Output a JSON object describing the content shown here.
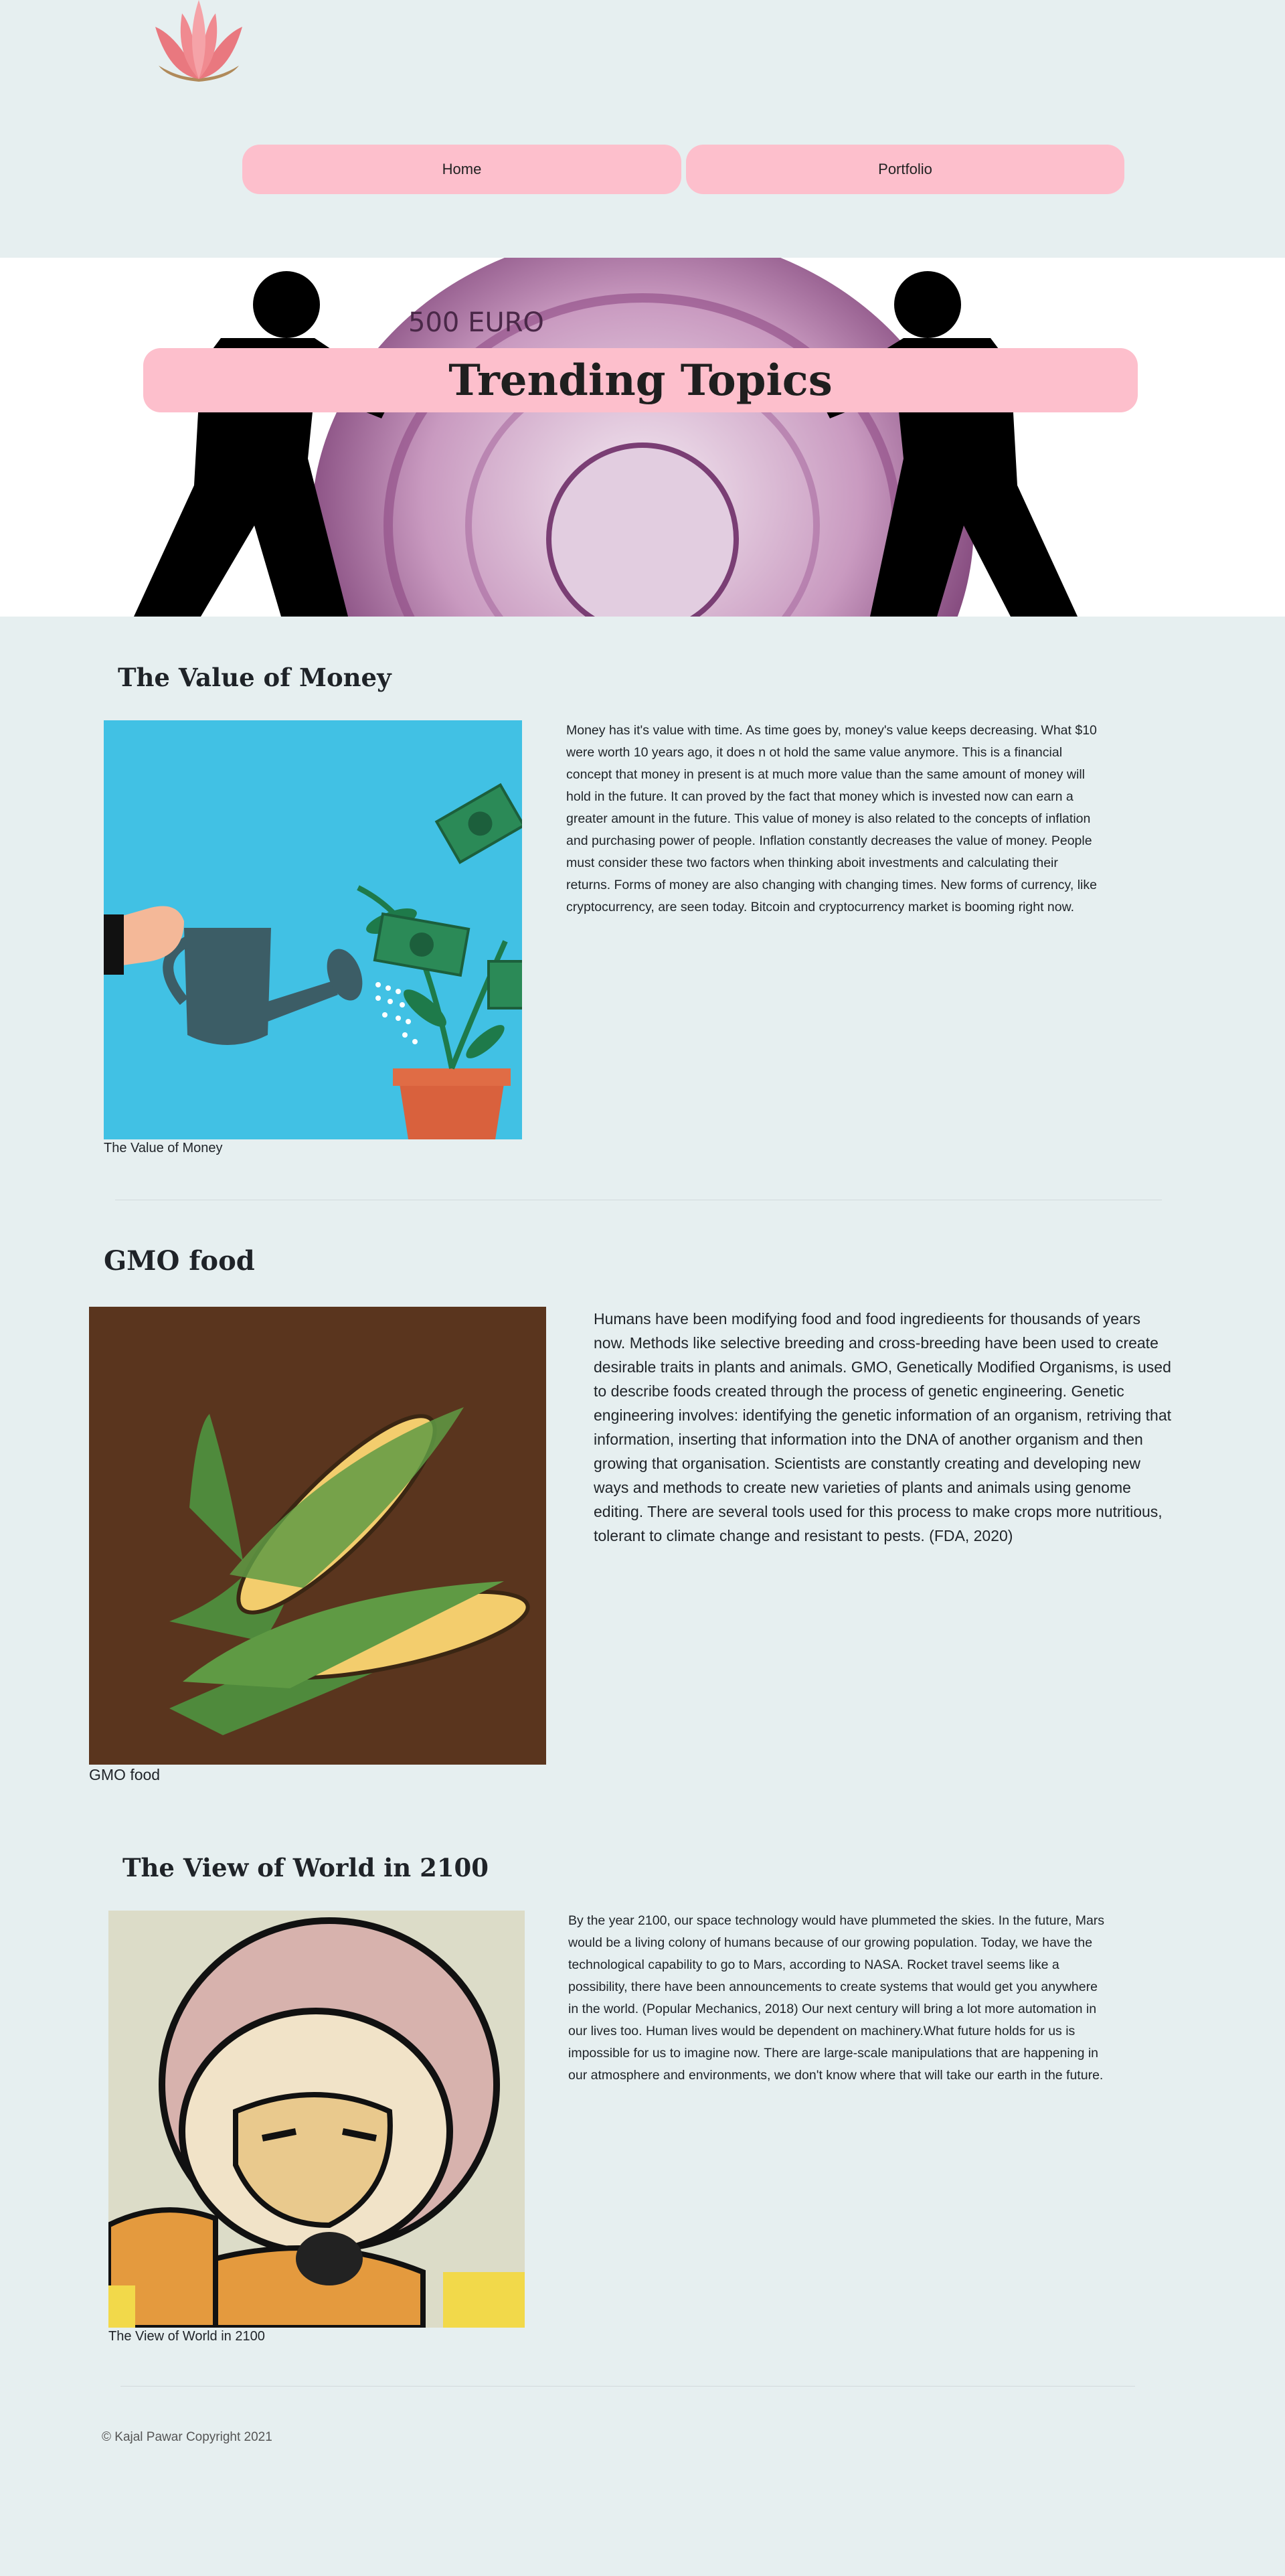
{
  "header": {
    "logo_icon": "lotus-icon",
    "nav": [
      {
        "label": "Home"
      },
      {
        "label": "Portfolio"
      }
    ]
  },
  "hero": {
    "title": "Trending Topics",
    "banner_text": "500 EURO"
  },
  "sections": [
    {
      "title": "The Value of Money",
      "image_icon": "watering-money-plant-illustration",
      "text": "Money has it's value with time. As time goes by, money's value keeps decreasing. What $10 were worth 10 years ago, it does n ot hold the same value anymore. This is a financial concept that money in present is at much more value than the same amount of money will hold in the future. It can proved by the fact that money which is invested now can earn a greater amount in the future. This value of money is also related to the concepts of inflation and purchasing power of people. Inflation constantly decreases the value of money. People must consider these two factors when thinking aboit investments and calculating their returns. Forms of money are also changing with changing times. New forms of currency, like cryptocurrency, are seen today. Bitcoin and cryptocurrency market is booming right now.",
      "caption": "The Value of Money"
    },
    {
      "title": "GMO food",
      "image_icon": "corn-illustration",
      "text": "Humans have been modifying food and food ingredieents for thousands of years now. Methods like selective breeding and cross-breeding have been used to create desirable traits in plants and animals. GMO, Genetically Modified Organisms, is used to describe foods created through the process of genetic engineering. Genetic engineering involves: identifying the genetic information of an organism, retriving that information, inserting that information into the DNA of another organism and then growing that organisation. Scientists are constantly creating and developing new ways and methods to create new varieties of plants and animals using genome editing. There are several tools used for this process to make crops more nutritious, tolerant to climate change and resistant to pests. (FDA, 2020)",
      "caption": "GMO food"
    },
    {
      "title": "The View of World in 2100",
      "image_icon": "astronaut-illustration",
      "text": "By the year 2100, our space technology would have plummeted the skies. In the future, Mars would be a living colony of humans because of our growing population. Today, we have the technological capability to go to Mars, according to NASA. Rocket travel seems like a possibility, there have been announcements to create systems that would get you anywhere in the world. (Popular Mechanics, 2018) Our next century will bring a lot more automation in our lives too. Human lives would be dependent on machinery.What future holds for us is impossible for us to imagine now. There are large-scale manipulations that are happening in our atmosphere and environments, we don't know where that will take our earth in the future.",
      "caption": "The View of World in 2100"
    }
  ],
  "footer": {
    "copyright": "© Kajal Pawar Copyright 2021"
  }
}
